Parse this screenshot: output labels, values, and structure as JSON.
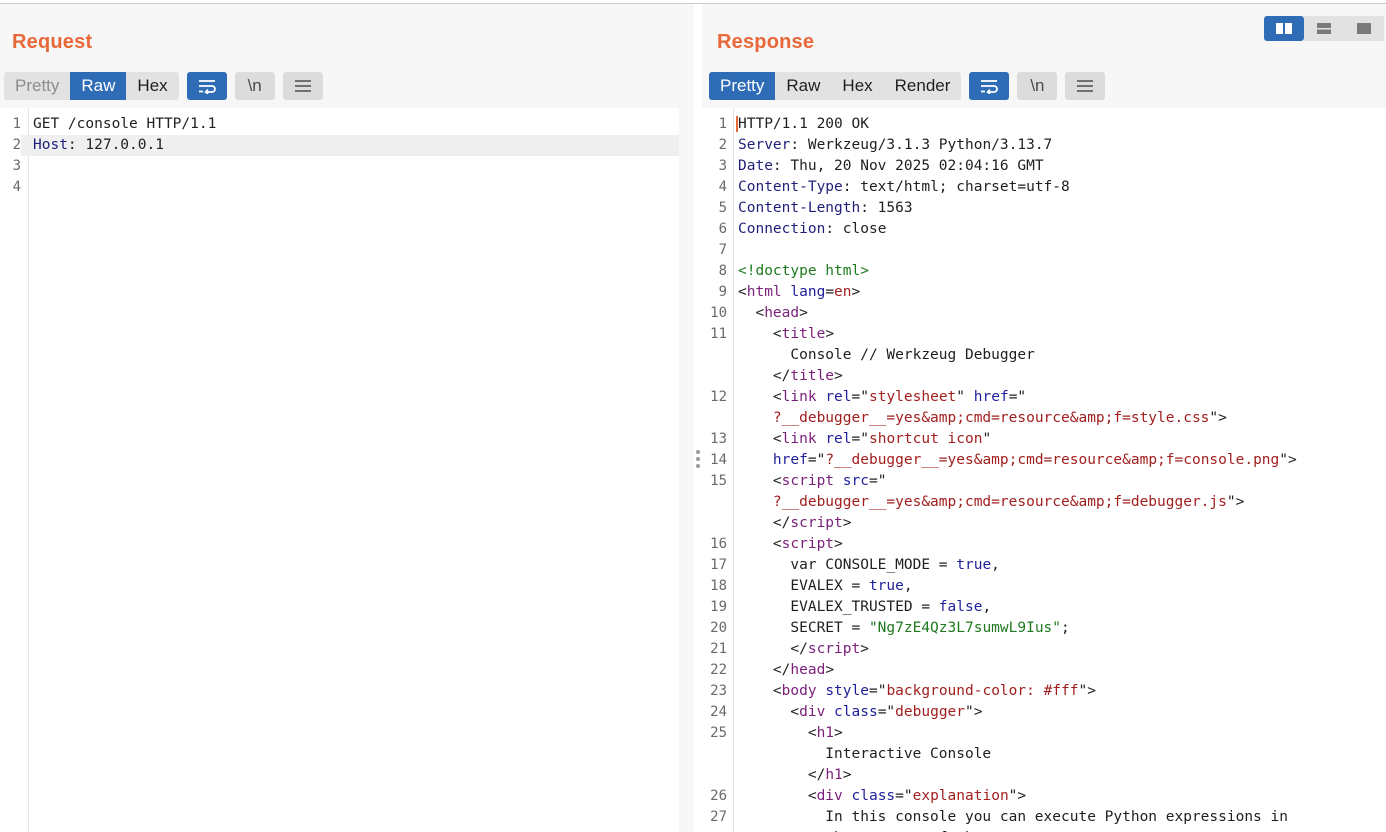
{
  "request": {
    "title": "Request",
    "tabs": [
      "Pretty",
      "Raw",
      "Hex"
    ],
    "active_tab": "Raw",
    "lines": [
      {
        "n": "1",
        "parts": [
          {
            "t": "GET /console HTTP/1.1",
            "c": ""
          }
        ]
      },
      {
        "n": "2",
        "parts": [
          {
            "t": "Host",
            "c": "k"
          },
          {
            "t": ": 127.0.0.1",
            "c": ""
          }
        ],
        "highlight": true
      },
      {
        "n": "3",
        "parts": []
      },
      {
        "n": "4",
        "parts": []
      }
    ]
  },
  "response": {
    "title": "Response",
    "tabs": [
      "Pretty",
      "Raw",
      "Hex",
      "Render"
    ],
    "active_tab": "Pretty",
    "lines": [
      {
        "n": "1",
        "parts": [
          {
            "t": "HTTP/1.1 200 OK",
            "c": ""
          }
        ],
        "cursor": true
      },
      {
        "n": "2",
        "parts": [
          {
            "t": "Server",
            "c": "k"
          },
          {
            "t": ": Werkzeug/3.1.3 Python/3.13.7",
            "c": ""
          }
        ]
      },
      {
        "n": "3",
        "parts": [
          {
            "t": "Date",
            "c": "k"
          },
          {
            "t": ": Thu, 20 Nov 2025 02:04:16 GMT",
            "c": ""
          }
        ]
      },
      {
        "n": "4",
        "parts": [
          {
            "t": "Content-Type",
            "c": "k"
          },
          {
            "t": ": text/html; charset=utf-8",
            "c": ""
          }
        ]
      },
      {
        "n": "5",
        "parts": [
          {
            "t": "Content-Length",
            "c": "k"
          },
          {
            "t": ": 1563",
            "c": ""
          }
        ]
      },
      {
        "n": "6",
        "parts": [
          {
            "t": "Connection",
            "c": "k"
          },
          {
            "t": ": close",
            "c": ""
          }
        ]
      },
      {
        "n": "7",
        "parts": []
      },
      {
        "n": "8",
        "parts": [
          {
            "t": "<!doctype html>",
            "c": "grn"
          }
        ]
      },
      {
        "n": "9",
        "parts": [
          {
            "t": "<",
            "c": ""
          },
          {
            "t": "html",
            "c": "tag"
          },
          {
            "t": " ",
            "c": ""
          },
          {
            "t": "lang",
            "c": "attr"
          },
          {
            "t": "=",
            "c": ""
          },
          {
            "t": "en",
            "c": "str"
          },
          {
            "t": ">",
            "c": ""
          }
        ]
      },
      {
        "n": "10",
        "parts": [
          {
            "t": "  <",
            "c": ""
          },
          {
            "t": "head",
            "c": "tag"
          },
          {
            "t": ">",
            "c": ""
          }
        ]
      },
      {
        "n": "11",
        "parts": [
          {
            "t": "    <",
            "c": ""
          },
          {
            "t": "title",
            "c": "tag"
          },
          {
            "t": ">",
            "c": ""
          }
        ]
      },
      {
        "n": "",
        "parts": [
          {
            "t": "      Console // Werkzeug Debugger",
            "c": ""
          }
        ]
      },
      {
        "n": "",
        "parts": [
          {
            "t": "    </",
            "c": ""
          },
          {
            "t": "title",
            "c": "tag"
          },
          {
            "t": ">",
            "c": ""
          }
        ]
      },
      {
        "n": "12",
        "parts": [
          {
            "t": "    <",
            "c": ""
          },
          {
            "t": "link",
            "c": "tag"
          },
          {
            "t": " ",
            "c": ""
          },
          {
            "t": "rel",
            "c": "attr"
          },
          {
            "t": "=\"",
            "c": ""
          },
          {
            "t": "stylesheet",
            "c": "str"
          },
          {
            "t": "\" ",
            "c": ""
          },
          {
            "t": "href",
            "c": "attr"
          },
          {
            "t": "=\"",
            "c": ""
          }
        ]
      },
      {
        "n": "",
        "parts": [
          {
            "t": "    ",
            "c": ""
          },
          {
            "t": "?__debugger__=yes&amp;cmd=resource&amp;f=style.css",
            "c": "str"
          },
          {
            "t": "\">",
            "c": ""
          }
        ]
      },
      {
        "n": "13",
        "parts": [
          {
            "t": "    <",
            "c": ""
          },
          {
            "t": "link",
            "c": "tag"
          },
          {
            "t": " ",
            "c": ""
          },
          {
            "t": "rel",
            "c": "attr"
          },
          {
            "t": "=\"",
            "c": ""
          },
          {
            "t": "shortcut icon",
            "c": "str"
          },
          {
            "t": "\"",
            "c": ""
          }
        ]
      },
      {
        "n": "14",
        "parts": [
          {
            "t": "    ",
            "c": ""
          },
          {
            "t": "href",
            "c": "attr"
          },
          {
            "t": "=\"",
            "c": ""
          },
          {
            "t": "?__debugger__=yes&amp;cmd=resource&amp;f=console.png",
            "c": "str"
          },
          {
            "t": "\">",
            "c": ""
          }
        ]
      },
      {
        "n": "15",
        "parts": [
          {
            "t": "    <",
            "c": ""
          },
          {
            "t": "script",
            "c": "tag"
          },
          {
            "t": " ",
            "c": ""
          },
          {
            "t": "src",
            "c": "attr"
          },
          {
            "t": "=\"",
            "c": ""
          }
        ]
      },
      {
        "n": "",
        "parts": [
          {
            "t": "    ",
            "c": ""
          },
          {
            "t": "?__debugger__=yes&amp;cmd=resource&amp;f=debugger.js",
            "c": "str"
          },
          {
            "t": "\">",
            "c": ""
          }
        ]
      },
      {
        "n": "",
        "parts": [
          {
            "t": "    </",
            "c": ""
          },
          {
            "t": "script",
            "c": "tag"
          },
          {
            "t": ">",
            "c": ""
          }
        ]
      },
      {
        "n": "16",
        "parts": [
          {
            "t": "    <",
            "c": ""
          },
          {
            "t": "script",
            "c": "tag"
          },
          {
            "t": ">",
            "c": ""
          }
        ]
      },
      {
        "n": "17",
        "parts": [
          {
            "t": "      var CONSOLE_MODE = ",
            "c": ""
          },
          {
            "t": "true",
            "c": "kw"
          },
          {
            "t": ",",
            "c": ""
          }
        ]
      },
      {
        "n": "18",
        "parts": [
          {
            "t": "      EVALEX = ",
            "c": ""
          },
          {
            "t": "true",
            "c": "kw"
          },
          {
            "t": ",",
            "c": ""
          }
        ]
      },
      {
        "n": "19",
        "parts": [
          {
            "t": "      EVALEX_TRUSTED = ",
            "c": ""
          },
          {
            "t": "false",
            "c": "kw"
          },
          {
            "t": ",",
            "c": ""
          }
        ]
      },
      {
        "n": "20",
        "parts": [
          {
            "t": "      SECRET = ",
            "c": ""
          },
          {
            "t": "\"Ng7zE4Qz3L7sumwL9Ius\"",
            "c": "grn"
          },
          {
            "t": ";",
            "c": ""
          }
        ]
      },
      {
        "n": "21",
        "parts": [
          {
            "t": "      </",
            "c": ""
          },
          {
            "t": "script",
            "c": "tag"
          },
          {
            "t": ">",
            "c": ""
          }
        ]
      },
      {
        "n": "22",
        "parts": [
          {
            "t": "    </",
            "c": ""
          },
          {
            "t": "head",
            "c": "tag"
          },
          {
            "t": ">",
            "c": ""
          }
        ]
      },
      {
        "n": "23",
        "parts": [
          {
            "t": "    <",
            "c": ""
          },
          {
            "t": "body",
            "c": "tag"
          },
          {
            "t": " ",
            "c": ""
          },
          {
            "t": "style",
            "c": "attr"
          },
          {
            "t": "=\"",
            "c": ""
          },
          {
            "t": "background-color: #fff",
            "c": "str"
          },
          {
            "t": "\">",
            "c": ""
          }
        ]
      },
      {
        "n": "24",
        "parts": [
          {
            "t": "      <",
            "c": ""
          },
          {
            "t": "div",
            "c": "tag"
          },
          {
            "t": " ",
            "c": ""
          },
          {
            "t": "class",
            "c": "attr"
          },
          {
            "t": "=\"",
            "c": ""
          },
          {
            "t": "debugger",
            "c": "str"
          },
          {
            "t": "\">",
            "c": ""
          }
        ]
      },
      {
        "n": "25",
        "parts": [
          {
            "t": "        <",
            "c": ""
          },
          {
            "t": "h1",
            "c": "tag"
          },
          {
            "t": ">",
            "c": ""
          }
        ]
      },
      {
        "n": "",
        "parts": [
          {
            "t": "          Interactive Console",
            "c": ""
          }
        ]
      },
      {
        "n": "",
        "parts": [
          {
            "t": "        </",
            "c": ""
          },
          {
            "t": "h1",
            "c": "tag"
          },
          {
            "t": ">",
            "c": ""
          }
        ]
      },
      {
        "n": "26",
        "parts": [
          {
            "t": "        <",
            "c": ""
          },
          {
            "t": "div",
            "c": "tag"
          },
          {
            "t": " ",
            "c": ""
          },
          {
            "t": "class",
            "c": "attr"
          },
          {
            "t": "=\"",
            "c": ""
          },
          {
            "t": "explanation",
            "c": "str"
          },
          {
            "t": "\">",
            "c": ""
          }
        ]
      },
      {
        "n": "27",
        "parts": [
          {
            "t": "          In this console you can execute Python expressions in",
            "c": ""
          }
        ]
      },
      {
        "n": "",
        "parts": [
          {
            "t": "          the context of the",
            "c": ""
          }
        ]
      }
    ]
  },
  "view_modes": [
    "side-by-side-icon",
    "stacked-icon",
    "single-pane-icon"
  ],
  "active_view_mode": "side-by-side-icon",
  "icons": {
    "wrap": "word-wrap-icon",
    "newline": "\\n",
    "menu": "menu-icon"
  },
  "colors": {
    "accent": "#e8683a",
    "active_tab": "#2e6cb6"
  }
}
